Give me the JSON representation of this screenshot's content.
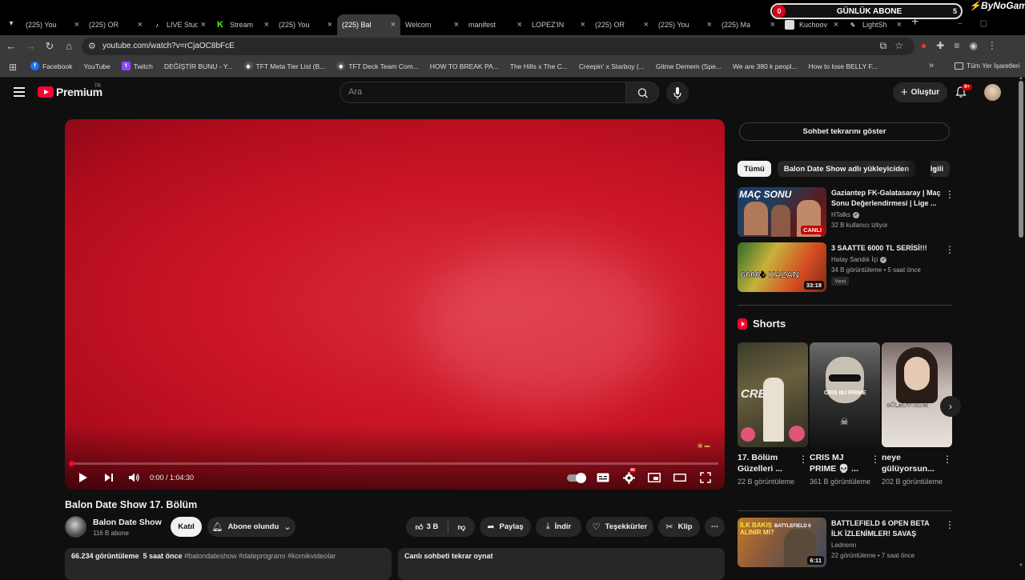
{
  "browser": {
    "tabs": [
      {
        "title": "(225) You",
        "favicon": "youtube-icon"
      },
      {
        "title": "(225) OR",
        "favicon": "youtube-icon"
      },
      {
        "title": "LIVE Stud",
        "favicon": "tiktok-icon"
      },
      {
        "title": "Stream",
        "favicon": "kick-icon"
      },
      {
        "title": "(225) You",
        "favicon": "youtube-icon"
      },
      {
        "title": "(225) Bal",
        "favicon": "youtube-icon",
        "active": true
      },
      {
        "title": "Welcom",
        "favicon": "youtube-icon"
      },
      {
        "title": "manifest",
        "favicon": "youtube-icon"
      },
      {
        "title": "LOPEZ'IN",
        "favicon": "youtube-icon"
      },
      {
        "title": "(225) OR",
        "favicon": "youtube-icon"
      },
      {
        "title": "(225) You",
        "favicon": "youtube-icon"
      },
      {
        "title": "(225) Ma",
        "favicon": "youtube-icon"
      },
      {
        "title": "Kuchoov",
        "favicon": "extension-icon"
      },
      {
        "title": "LightSh",
        "favicon": "lightshot-icon"
      }
    ],
    "url": "youtube.com/watch?v=rCjaOC8bFcE",
    "bookmarks": [
      {
        "label": "Facebook",
        "icon": "facebook-icon"
      },
      {
        "label": "YouTube",
        "icon": "youtube-icon"
      },
      {
        "label": "Twitch",
        "icon": "twitch-icon"
      },
      {
        "label": "DEĞİŞTİR BUNU - Y...",
        "icon": "youtube-icon"
      },
      {
        "label": "TFT Meta Tier List (B...",
        "icon": "tft-icon"
      },
      {
        "label": "TFT Deck Team Com...",
        "icon": "tft-icon"
      },
      {
        "label": "HOW TO BREAK PA...",
        "icon": "youtube-icon"
      },
      {
        "label": "The Hills x The C...",
        "icon": "youtube-icon"
      },
      {
        "label": "Creepin' x Starboy (...",
        "icon": "youtube-icon"
      },
      {
        "label": "Gitme Demem (Spe...",
        "icon": "youtube-icon"
      },
      {
        "label": "We are 380 k peopl...",
        "icon": "youtube-icon"
      },
      {
        "label": "How to lose BELLY F...",
        "icon": "youtube-icon"
      }
    ],
    "all_bookmarks": "Tüm Yer İşaretleri"
  },
  "overlay": {
    "counter_left": "0",
    "counter_label": "GÜNLÜK ABONE",
    "counter_right": "5",
    "brand": "ByNoGame"
  },
  "header": {
    "logo_text": "Premium",
    "logo_country": "TR",
    "search_placeholder": "Ara",
    "create_label": "Oluştur",
    "notif_count": "9+"
  },
  "player": {
    "time": "0:00 / 1:04:30",
    "progress": 0
  },
  "video": {
    "title": "Balon Date Show 17. Bölüm",
    "channel": "Balon Date Show",
    "subscribers": "116 B abone",
    "join_label": "Katıl",
    "subscribed_label": "Abone olundu",
    "likes": "3 B",
    "share_label": "Paylaş",
    "download_label": "İndir",
    "thanks_label": "Teşekkürler",
    "clip_label": "Klip",
    "views_time": "66.234 görüntüleme  5 saat önce",
    "tags": "#balondateshow #dateprogramı #komikvideolar",
    "live_replay": "Canlı sohbeti tekrar oynat"
  },
  "sidebar": {
    "chat_replay": "Sohbet tekrarını göster",
    "chips": [
      "Tümü",
      "Balon Date Show adlı yükleyiciden",
      "İlgili"
    ],
    "recs": [
      {
        "title": "Gaziantep FK-Galatasaray | Maç Sonu Değerlendirmesi | Lige ...",
        "channel": "HTalks",
        "meta": "32 B kullanıcı izliyor",
        "badge": "CANLI",
        "thumb_text": "MAÇ SONU"
      },
      {
        "title": "3 SAATTE 6000 TL SERİSİ!!!",
        "channel": "Hatay Sandık İçi",
        "meta": "34 B görüntüleme • 5 saat önce",
        "badge": "33:18",
        "new_label": "Yeni",
        "thumb_text": "6000₺ KAZAN"
      }
    ],
    "shorts_title": "Shorts",
    "shorts": [
      {
        "title": "17. Bölüm Güzelleri ...",
        "views": "22 B görüntüleme",
        "thumb_text": "CREW"
      },
      {
        "title": "CRIS MJ PRIME 💀 ...",
        "views": "361 B görüntüleme",
        "thumb_text": "CRIS MJ PRIME"
      },
      {
        "title": "neye gülüyorsun...",
        "views": "202 B görüntüleme",
        "thumb_text": "GÜLMÜYORUM"
      }
    ],
    "rec3": {
      "title": "BATTLEFIELD 6 OPEN BETA İLK İZLENİMLER! SAVAŞ BAŞLADI...",
      "channel": "Ledrienn",
      "meta": "22 görüntüleme • 7 saat önce",
      "badge": "6:11",
      "thumb_text": "İLK BAKIŞ ALINIR MI?",
      "thumb_text2": "BATTLEFIELD 6"
    }
  },
  "colors": {
    "accent": "#ff0033",
    "background": "#0f0f0f",
    "surface": "#272727"
  }
}
